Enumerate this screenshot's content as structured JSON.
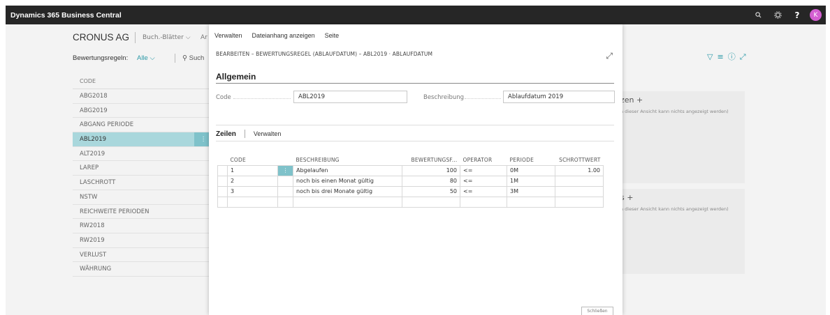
{
  "appbar": {
    "title": "Dynamics 365 Business Central",
    "icons": [
      "search-icon",
      "gear-icon",
      "help-icon"
    ],
    "help_glyph": "?",
    "avatar_initial": "K"
  },
  "background": {
    "company": "CRONUS AG",
    "nav_item1": "Buch.-Blätter",
    "nav_item2": "Ar",
    "filter_label": "Bewertungsregeln:",
    "filter_value": "Alle",
    "search_label": "Such",
    "list_header": "CODE",
    "list_rows": [
      "ABG2018",
      "ABG2019",
      "ABGANG PERIODE",
      "ABL2019",
      "ALT2019",
      "LAREP",
      "LASCHROTT",
      "NSTW",
      "REICHWEITE PERIODEN",
      "RW2018",
      "RW2019",
      "VERLUST",
      "WÄHRUNG"
    ],
    "selected_row": "ABL2019",
    "panel1_title": "zen",
    "panel1_msg": "n dieser Ansicht kann nichts angezeigt werden)",
    "panel2_title": "s",
    "panel2_msg": "n dieser Ansicht kann nichts angezeigt werden)",
    "accent": "#2e9aa8"
  },
  "modal": {
    "actions": [
      "Verwalten",
      "Dateianhang anzeigen",
      "Seite"
    ],
    "title": "BEARBEITEN – BEWERTUNGSREGEL (ABLAUFDATUM) – ABL2019 · ABLAUFDATUM",
    "section": "Allgemein",
    "code_label": "Code",
    "code_value": "ABL2019",
    "desc_label": "Beschreibung",
    "desc_value": "Ablaufdatum 2019",
    "tab_lines": "Zeilen",
    "tab_manage": "Verwalten",
    "columns": [
      "CODE",
      "BESCHREIBUNG",
      "BEWERTUNGSF...",
      "OPERATOR",
      "PERIODE",
      "SCHROTTWERT"
    ],
    "rows": [
      {
        "code": "1",
        "desc": "Abgelaufen",
        "factor": "100",
        "op": "<=",
        "period": "0M",
        "scrap": "1.00"
      },
      {
        "code": "2",
        "desc": "noch bis einen Monat gültig",
        "factor": "80",
        "op": "<=",
        "period": "1M",
        "scrap": ""
      },
      {
        "code": "3",
        "desc": "noch bis drei Monate gültig",
        "factor": "50",
        "op": "<=",
        "period": "3M",
        "scrap": ""
      }
    ],
    "close_label": "Schließen"
  }
}
